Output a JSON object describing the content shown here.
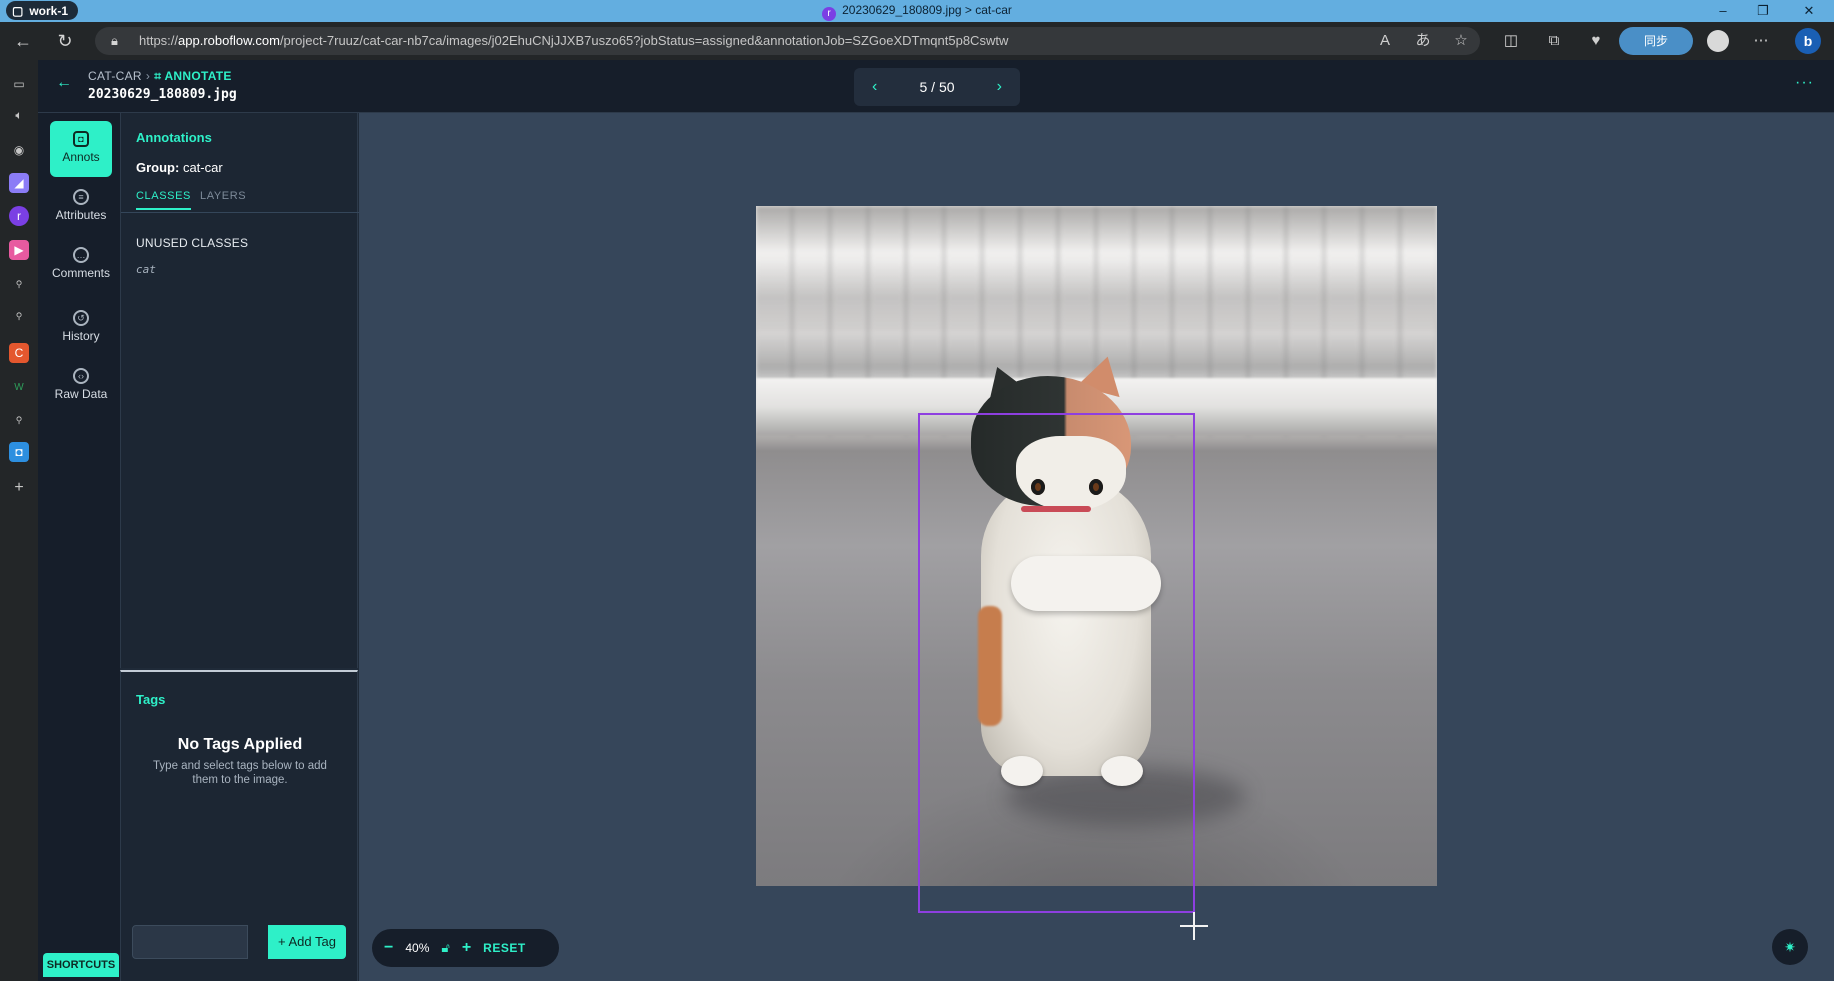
{
  "browser": {
    "profile_name": "work-1",
    "window_title": "20230629_180809.jpg > cat-car",
    "url_prefix": "https://",
    "url_domain": "app.roboflow.com",
    "url_path": "/project-7ruuz/cat-car-nb7ca/images/j02EhuCNjJJXB7uszo65?jobStatus=assigned&annotationJob=SZGoeXDTmqnt5p8Cswtw",
    "sync_label": "同步"
  },
  "header": {
    "project": "CAT-CAR",
    "mode": "ANNOTATE",
    "filename": "20230629_180809.jpg",
    "pager": "5 / 50"
  },
  "rail": {
    "items": [
      {
        "label": "Annots"
      },
      {
        "label": "Attributes"
      },
      {
        "label": "Comments"
      },
      {
        "label": "History"
      },
      {
        "label": "Raw Data"
      }
    ],
    "shortcuts": "SHORTCUTS"
  },
  "annotations": {
    "title": "Annotations",
    "group_key": "Group:",
    "group_value": "cat-car",
    "tabs": [
      "CLASSES",
      "LAYERS"
    ],
    "unused_heading": "UNUSED CLASSES",
    "unused_classes": [
      "cat"
    ]
  },
  "tags": {
    "title": "Tags",
    "empty_title": "No Tags Applied",
    "empty_sub": "Type and select tags below to add them to the image.",
    "input_placeholder": "",
    "add_label": "+ Add Tag"
  },
  "zoom": {
    "minus": "−",
    "level": "40%",
    "plus": "+",
    "reset": "RESET"
  },
  "colors": {
    "accent": "#2ef0c8",
    "bbox": "#8e3fe0"
  }
}
